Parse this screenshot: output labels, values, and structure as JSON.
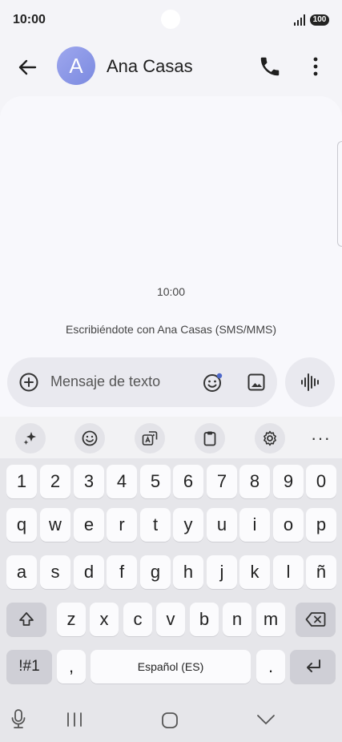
{
  "status_bar": {
    "time": "10:00",
    "battery": "100"
  },
  "header": {
    "avatar_letter": "A",
    "contact_name": "Ana Casas"
  },
  "conversation": {
    "timestamp": "10:00",
    "info": "Escribiéndote con Ana Casas (SMS/MMS)"
  },
  "composer": {
    "placeholder": "Mensaje de texto"
  },
  "keyboard": {
    "number_row": [
      "1",
      "2",
      "3",
      "4",
      "5",
      "6",
      "7",
      "8",
      "9",
      "0"
    ],
    "row1": [
      "q",
      "w",
      "e",
      "r",
      "t",
      "y",
      "u",
      "i",
      "o",
      "p"
    ],
    "row2": [
      "a",
      "s",
      "d",
      "f",
      "g",
      "h",
      "j",
      "k",
      "l",
      "ñ"
    ],
    "row3": [
      "z",
      "x",
      "c",
      "v",
      "b",
      "n",
      "m"
    ],
    "symbols_key": "!#1",
    "comma_key": ",",
    "space_label": "Español (ES)",
    "period_key": "."
  },
  "toolbar_more": "···"
}
